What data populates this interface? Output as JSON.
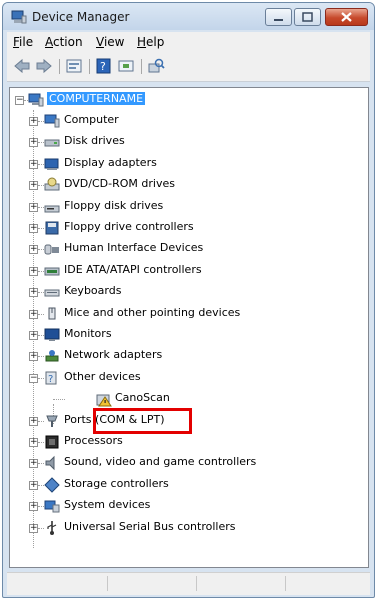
{
  "window": {
    "title": "Device Manager"
  },
  "menu": [
    {
      "label": "File",
      "accel": "F",
      "rest": "ile"
    },
    {
      "label": "Action",
      "accel": "A",
      "rest": "ction"
    },
    {
      "label": "View",
      "accel": "V",
      "rest": "iew"
    },
    {
      "label": "Help",
      "accel": "H",
      "rest": "elp"
    }
  ],
  "toolbar": [
    "back-icon",
    "forward-icon",
    "properties-icon",
    "help-icon",
    "update-driver-icon",
    "scan-hardware-icon"
  ],
  "tree": {
    "root": "COMPUTERNAME",
    "categories": [
      {
        "label": "Computer",
        "icon": "computer-icon"
      },
      {
        "label": "Disk drives",
        "icon": "disk-drive-icon"
      },
      {
        "label": "Display adapters",
        "icon": "display-adapter-icon"
      },
      {
        "label": "DVD/CD-ROM drives",
        "icon": "dvd-drive-icon"
      },
      {
        "label": "Floppy disk drives",
        "icon": "floppy-drive-icon"
      },
      {
        "label": "Floppy drive controllers",
        "icon": "floppy-controller-icon"
      },
      {
        "label": "Human Interface Devices",
        "icon": "hid-icon"
      },
      {
        "label": "IDE ATA/ATAPI controllers",
        "icon": "ide-controller-icon"
      },
      {
        "label": "Keyboards",
        "icon": "keyboard-icon"
      },
      {
        "label": "Mice and other pointing devices",
        "icon": "mouse-icon"
      },
      {
        "label": "Monitors",
        "icon": "monitor-icon"
      },
      {
        "label": "Network adapters",
        "icon": "network-adapter-icon"
      },
      {
        "label": "Other devices",
        "icon": "other-devices-icon",
        "expanded": true,
        "children": [
          {
            "label": "CanoScan",
            "icon": "warning-device-icon"
          }
        ]
      },
      {
        "label": "Ports (COM & LPT)",
        "icon": "port-icon"
      },
      {
        "label": "Processors",
        "icon": "processor-icon"
      },
      {
        "label": "Sound, video and game controllers",
        "icon": "sound-icon"
      },
      {
        "label": "Storage controllers",
        "icon": "storage-controller-icon"
      },
      {
        "label": "System devices",
        "icon": "system-devices-icon"
      },
      {
        "label": "Universal Serial Bus controllers",
        "icon": "usb-icon"
      }
    ]
  },
  "colors": {
    "selection": "#3399ff",
    "highlight_box": "#e30000"
  }
}
